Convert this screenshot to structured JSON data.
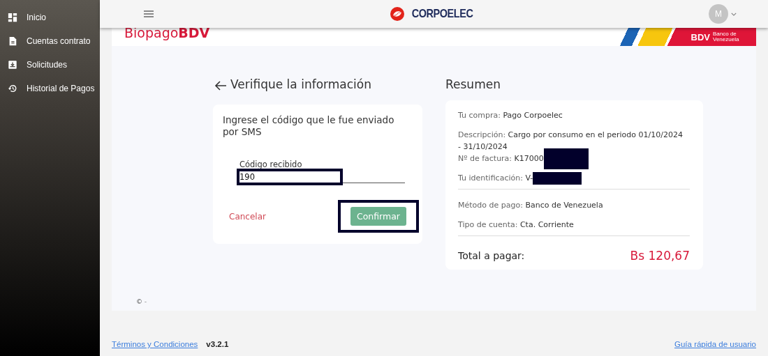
{
  "sidebar": {
    "items": [
      {
        "label": "Inicio"
      },
      {
        "label": "Cuentas contrato"
      },
      {
        "label": "Solicitudes"
      },
      {
        "label": "Historial de Pagos"
      }
    ]
  },
  "header": {
    "logo": "CORPOELEC",
    "avatar": "M"
  },
  "banner": {
    "brand": "Biopago",
    "brand_bold": "BDV",
    "bank_mark": "BDV",
    "bank_name": "Banco de Venezuela"
  },
  "verify": {
    "title": "Verifique la información",
    "prompt": "Ingrese el código que le fue enviado por SMS",
    "field_label": "Código recibido",
    "field_value": "190",
    "cancel": "Cancelar",
    "confirm": "Confirmar"
  },
  "summary": {
    "title": "Resumen",
    "rows": [
      {
        "label": "Tu compra:",
        "value": "Pago Corpoelec",
        "redacted": false,
        "divider_after": false
      },
      {
        "label": "Descripción:",
        "value": "Cargo por consumo en el periodo 01/10/2024 - 31/10/2024",
        "redacted": false,
        "divider_after": false
      },
      {
        "label": "Nº de factura:",
        "value": "K17000",
        "redacted": true,
        "divider_after": false
      },
      {
        "label": "Tu identificación:",
        "value": "V-",
        "redacted": true,
        "divider_after": true
      },
      {
        "label": "Método de pago:",
        "value": "Banco de Venezuela",
        "redacted": false,
        "divider_after": false
      },
      {
        "label": "Tipo de cuenta:",
        "value": "Cta. Corriente",
        "redacted": false,
        "divider_after": true
      }
    ],
    "total_label": "Total a pagar:",
    "total": "Bs 120,67"
  },
  "copyright": "© -",
  "footer": {
    "terms": "Términos y Condiciones",
    "version": "v3.2.1",
    "guide": "Guía rápida de usuario"
  }
}
